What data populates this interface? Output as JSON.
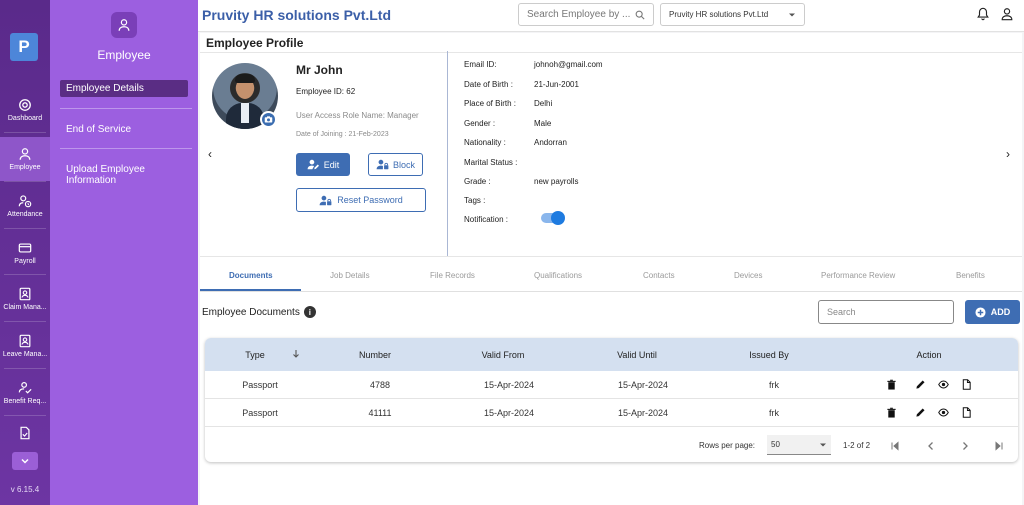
{
  "rail": {
    "logo": "P",
    "items": [
      {
        "label": "Dashboard"
      },
      {
        "label": "Employee"
      },
      {
        "label": "Attendance"
      },
      {
        "label": "Payroll"
      },
      {
        "label": "Claim Mana..."
      },
      {
        "label": "Leave Mana..."
      },
      {
        "label": "Benefit Req..."
      }
    ],
    "version": "v 6.15.4"
  },
  "subnav": {
    "title": "Employee",
    "items": [
      {
        "label": "Employee Details"
      },
      {
        "label": "End of Service"
      },
      {
        "label": "Upload Employee Information"
      }
    ]
  },
  "topbar": {
    "brand": "Pruvity HR solutions Pvt.Ltd",
    "search_placeholder": "Search Employee by ...",
    "company": "Pruvity HR solutions Pvt.Ltd"
  },
  "profile": {
    "page_title": "Employee Profile",
    "name": "Mr John",
    "employee_id": "Employee ID: 62",
    "role": "User Access Role Name: Manager",
    "doj": "Date of Joining : 21-Feb-2023",
    "edit_label": "Edit",
    "block_label": "Block",
    "reset_label": "Reset Password",
    "prev_arrow": "‹",
    "next_arrow": "›"
  },
  "details": {
    "email_label": "Email ID:",
    "email": "johnoh@gmail.com",
    "dob_label": "Date of Birth :",
    "dob": "21-Jun-2001",
    "pob_label": "Place of Birth :",
    "pob": "Delhi",
    "gender_label": "Gender :",
    "gender": "Male",
    "nationality_label": "Nationality :",
    "nationality": "Andorran",
    "marital_label": "Marital Status :",
    "marital": "",
    "grade_label": "Grade :",
    "grade": "new payrolls",
    "tags_label": "Tags :",
    "tags": "",
    "notification_label": "Notification :",
    "notification_on": true
  },
  "tabs": [
    "Documents",
    "Job Details",
    "File Records",
    "Qualifications",
    "Contacts",
    "Devices",
    "Performance Review",
    "Benefits"
  ],
  "documents": {
    "title": "Employee Documents",
    "search_placeholder": "Search",
    "add_label": "ADD",
    "columns": [
      "Type",
      "Number",
      "Valid From",
      "Valid Until",
      "Issued By",
      "Action"
    ],
    "rows": [
      {
        "type": "Passport",
        "number": "4788",
        "valid_from": "15-Apr-2024",
        "valid_until": "15-Apr-2024",
        "issued_by": "frk"
      },
      {
        "type": "Passport",
        "number": "41111",
        "valid_from": "15-Apr-2024",
        "valid_until": "15-Apr-2024",
        "issued_by": "frk"
      }
    ],
    "rows_per_page_label": "Rows per page:",
    "rows_per_page": "50",
    "range": "1-2 of 2"
  },
  "colors": {
    "rail": "#6d35a3",
    "subnav": "#9c5fe0",
    "accent": "#3e6db3",
    "table_header": "#d4e0f0"
  }
}
